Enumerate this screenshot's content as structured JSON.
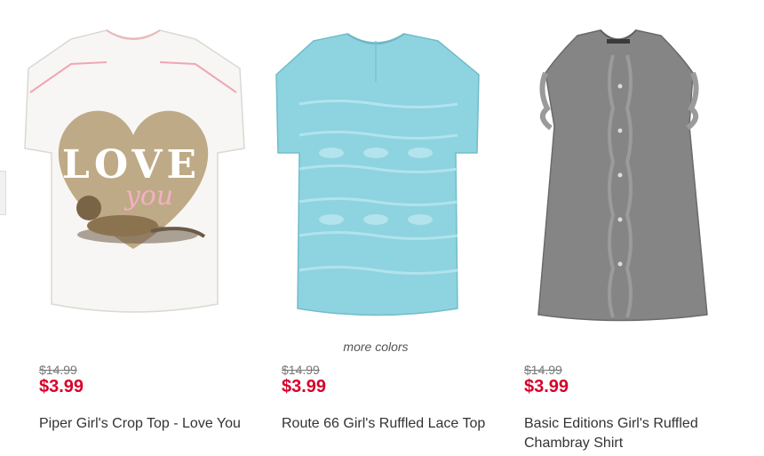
{
  "products": [
    {
      "title": "Piper Girl's Crop Top - Love You",
      "was_price": "$14.99",
      "price": "$3.99",
      "graphic_text": "LOVE",
      "graphic_script": "you"
    },
    {
      "title": "Route 66 Girl's Ruffled Lace Top",
      "was_price": "$14.99",
      "price": "$3.99",
      "more_colors": "more colors"
    },
    {
      "title": "Basic Editions Girl's Ruffled Chambray Shirt",
      "was_price": "$14.99",
      "price": "$3.99"
    }
  ],
  "colors": {
    "sale_price": "#d6002a",
    "was_price": "#777777",
    "title": "#333333",
    "shirt_white": "#f7f6f4",
    "shirt_aqua": "#8ed3e0",
    "shirt_chambray": "#858585",
    "heart_gold": "#b7a27a"
  }
}
